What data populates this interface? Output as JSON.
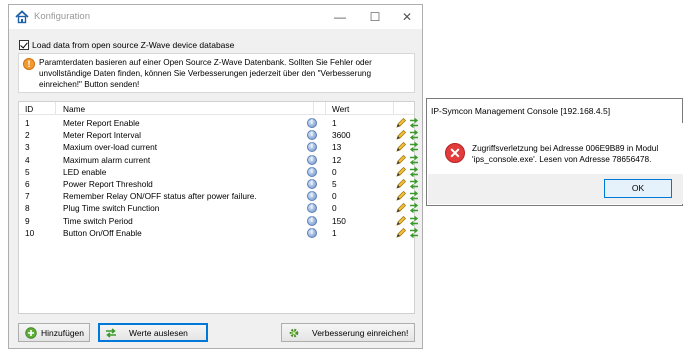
{
  "main_window": {
    "title": "Konfiguration",
    "minimize": "—",
    "maximize": "☐",
    "close": "✕",
    "checkbox_label": "Load data from open source Z-Wave device database",
    "info_text": "Paramterdaten basieren auf einer Open Source Z-Wave Datenbank. Sollten Sie Fehler oder unvollständige Daten finden, können Sie Verbesserungen jederzeit über den \"Verbesserung einreichen!\" Button senden!",
    "table": {
      "headers": {
        "id": "ID",
        "name": "Name",
        "value": "Wert"
      },
      "rows": [
        {
          "id": "1",
          "name": "Meter Report Enable",
          "value": "1"
        },
        {
          "id": "2",
          "name": "Meter Report Interval",
          "value": "3600"
        },
        {
          "id": "3",
          "name": "Maxium over-load current",
          "value": "13"
        },
        {
          "id": "4",
          "name": "Maximum alarm current",
          "value": "12"
        },
        {
          "id": "5",
          "name": "LED enable",
          "value": "0"
        },
        {
          "id": "6",
          "name": "Power Report Threshold",
          "value": "5"
        },
        {
          "id": "7",
          "name": "Remember Relay ON/OFF status after power failure.",
          "value": "0"
        },
        {
          "id": "8",
          "name": "Plug Time switch Function",
          "value": "0"
        },
        {
          "id": "9",
          "name": "Time switch Period",
          "value": "150"
        },
        {
          "id": "10",
          "name": "Button On/Off Enable",
          "value": "1"
        }
      ]
    },
    "buttons": {
      "add": "Hinzufügen",
      "read": "Werte auslesen",
      "submit": "Verbesserung einreichen!"
    },
    "icons": {
      "app": "home-icon",
      "info": "warning-icon",
      "help": "help-icon",
      "edit": "pencil-icon",
      "swap": "swap-arrows-icon"
    }
  },
  "dialog": {
    "title": "IP-Symcon Management Console [192.168.4.5]",
    "message": "Zugriffsverletzung bei Adresse 006E9B89 in Modul 'ips_console.exe'. Lesen von Adresse 78656478.",
    "ok": "OK",
    "icon": "error-icon"
  },
  "colors": {
    "accent": "#0078d7",
    "error": "#e23b3b",
    "warning": "#f29a30"
  }
}
